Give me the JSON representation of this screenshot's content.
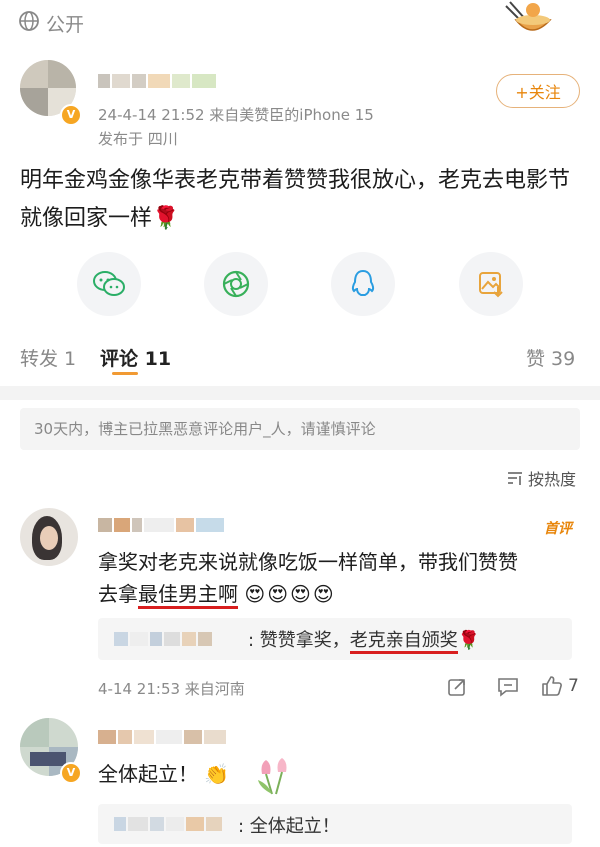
{
  "top_bar": {
    "visibility_label": "公开"
  },
  "post": {
    "meta_line": "24-4-14 21:52  来自美赞臣的iPhone 15",
    "location_line": "发布于 四川",
    "follow_label": "+关注",
    "text": "明年金鸡金像华表老克带着赞赞我很放心，老克去电影节就像回家一样",
    "rose_emoji": "🌹"
  },
  "share_icons": [
    "wechat-icon",
    "moments-icon",
    "qq-icon",
    "save-image-icon"
  ],
  "tabs": {
    "repost": "转发 1",
    "comments": "评论 11",
    "likes": "赞 39"
  },
  "notice": "30天内，博主已拉黑恶意评论用户_人，请谨慎评论",
  "sort_label": "按热度",
  "comments": [
    {
      "badge": "首评",
      "text_line1": "拿奖对老克来说就像吃饭一样简单，带我们赞赞",
      "text_line2_prefix": "去拿",
      "text_line2_underlined": "最佳男主啊",
      "emojis": "😍😍😍😍",
      "reply_text_prefix": ": 赞赞拿奖，",
      "reply_text_underlined": "老克亲自颁奖",
      "reply_emoji": "🌹",
      "meta": "4-14 21:53  来自河南",
      "like_count": "7"
    },
    {
      "text": "全体起立！",
      "emoji": "👏",
      "reply_text": "全体起立！"
    }
  ],
  "colors": {
    "accent_orange": "#e8860c",
    "link_blue": "#5b7bb5",
    "underline_red": "#d81e1e"
  }
}
